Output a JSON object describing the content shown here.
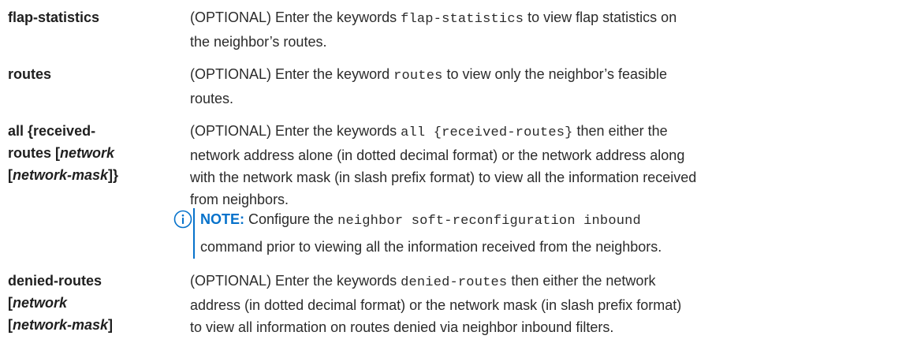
{
  "rows": [
    {
      "term": "flap-statistics",
      "desc": {
        "l1_pre": "(OPTIONAL) Enter the keywords ",
        "l1_code": "flap-statistics",
        "l1_post": " to view flap statistics on",
        "l2": "the neighbor’s routes."
      }
    },
    {
      "term": "routes",
      "desc": {
        "l1_pre": "(OPTIONAL) Enter the keyword ",
        "l1_code": "routes",
        "l1_post": " to view only the neighbor’s feasible",
        "l2": "routes."
      }
    },
    {
      "term_lines": {
        "l1": "all {received-",
        "l2_pre": "routes [",
        "l2_it": "network",
        "l3_pre": "[",
        "l3_it": "network-mask",
        "l3_post": "]}"
      },
      "desc": {
        "l1_pre": "(OPTIONAL) Enter the keywords ",
        "l1_code": "all {received-routes}",
        "l1_post": " then either the",
        "l2": "network address alone (in dotted decimal format) or the network address along",
        "l3": "with the network mask (in slash prefix format) to view all the information received",
        "l4": "from neighbors."
      },
      "note": {
        "label": "NOTE:",
        "l1_pre": " Configure the ",
        "l1_code": "neighbor soft-reconfiguration inbound",
        "l2": "command prior to viewing all the information received from the neighbors."
      }
    },
    {
      "term_lines": {
        "l1": "denied-routes",
        "l2_pre": "[",
        "l2_it": "network",
        "l3_pre": "[",
        "l3_it": "network-mask",
        "l3_post": "]"
      },
      "desc": {
        "l1_pre": "(OPTIONAL) Enter the keywords ",
        "l1_code": "denied-routes",
        "l1_post": " then either the network",
        "l2": "address (in dotted decimal format) or the network mask (in slash prefix format)",
        "l3": "to view all information on routes denied via neighbor inbound filters."
      }
    }
  ],
  "colors": {
    "text": "#2b2b2b",
    "note_accent": "#0672cb"
  },
  "icons": {
    "note": "info-circle-icon"
  }
}
